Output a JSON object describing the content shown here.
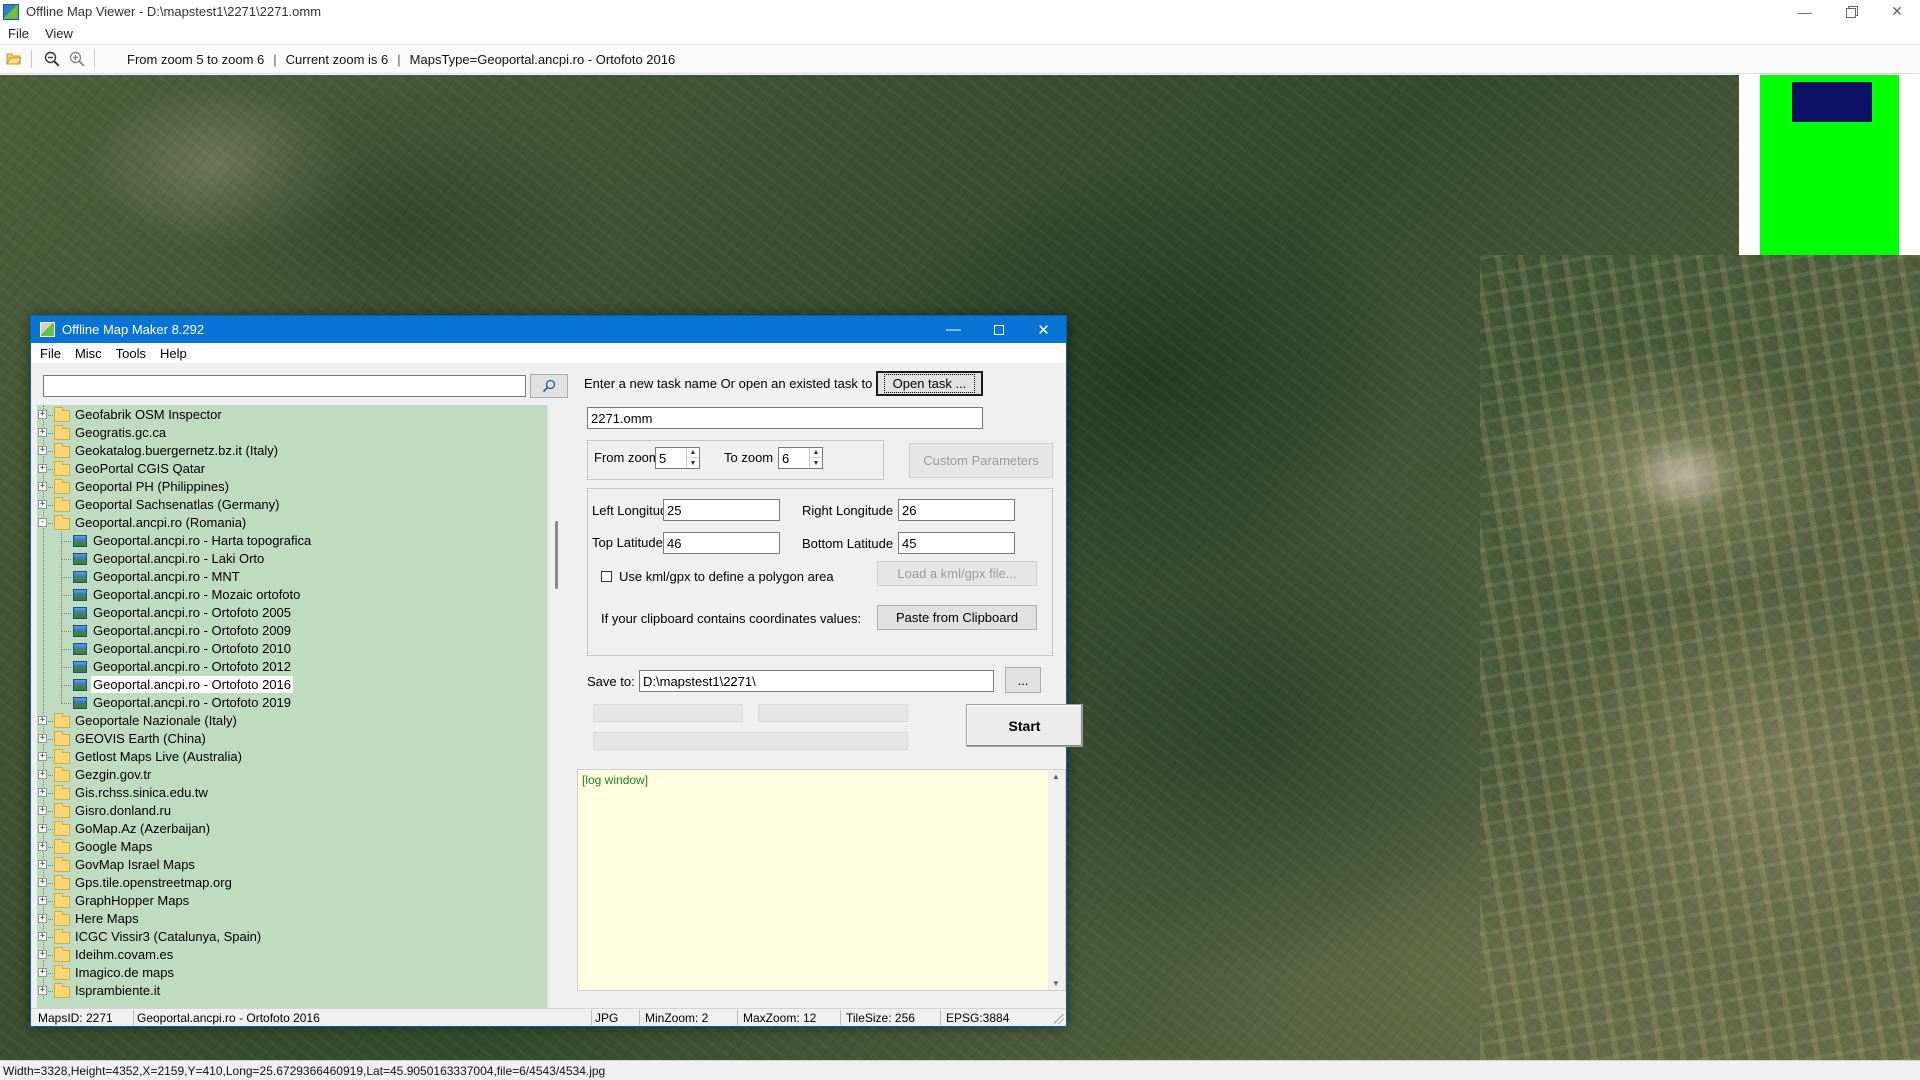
{
  "viewer": {
    "title": "Offline Map Viewer - D:\\mapstest1\\2271\\2271.omm",
    "menu": [
      "File",
      "View"
    ],
    "toolbar": {
      "zoom_range": "From zoom 5 to zoom 6",
      "current_zoom": "Current zoom is 6",
      "maps_type": "MapsType=Geoportal.ancpi.ro - Ortofoto 2016"
    },
    "status": "Width=3328,Height=4352,X=2159,Y=410,Long=25.6729366460919,Lat=45.9050163337004,file=6/4543/4534.jpg"
  },
  "dialog": {
    "title": "Offline Map Maker 8.292",
    "menu": [
      "File",
      "Misc",
      "Tools",
      "Help"
    ],
    "search": {
      "value": "",
      "placeholder": ""
    },
    "tree": [
      {
        "label": "Geofabrik OSM Inspector",
        "level": 0,
        "type": "folder",
        "expanded": false
      },
      {
        "label": "Geogratis.gc.ca",
        "level": 0,
        "type": "folder",
        "expanded": false
      },
      {
        "label": "Geokatalog.buergernetz.bz.it (Italy)",
        "level": 0,
        "type": "folder",
        "expanded": false
      },
      {
        "label": "GeoPortal CGIS Qatar",
        "level": 0,
        "type": "folder",
        "expanded": false
      },
      {
        "label": "Geoportal PH (Philippines)",
        "level": 0,
        "type": "folder",
        "expanded": false
      },
      {
        "label": "Geoportal Sachsenatlas (Germany)",
        "level": 0,
        "type": "folder",
        "expanded": false
      },
      {
        "label": "Geoportal.ancpi.ro (Romania)",
        "level": 0,
        "type": "folder",
        "expanded": true
      },
      {
        "label": "Geoportal.ancpi.ro - Harta topografica",
        "level": 1,
        "type": "map"
      },
      {
        "label": "Geoportal.ancpi.ro - Laki Orto",
        "level": 1,
        "type": "map"
      },
      {
        "label": "Geoportal.ancpi.ro - MNT",
        "level": 1,
        "type": "map"
      },
      {
        "label": "Geoportal.ancpi.ro - Mozaic ortofoto",
        "level": 1,
        "type": "map"
      },
      {
        "label": "Geoportal.ancpi.ro - Ortofoto 2005",
        "level": 1,
        "type": "map"
      },
      {
        "label": "Geoportal.ancpi.ro - Ortofoto 2009",
        "level": 1,
        "type": "map"
      },
      {
        "label": "Geoportal.ancpi.ro - Ortofoto 2010",
        "level": 1,
        "type": "map"
      },
      {
        "label": "Geoportal.ancpi.ro - Ortofoto 2012",
        "level": 1,
        "type": "map"
      },
      {
        "label": "Geoportal.ancpi.ro - Ortofoto 2016",
        "level": 1,
        "type": "map",
        "selected": true
      },
      {
        "label": "Geoportal.ancpi.ro - Ortofoto 2019",
        "level": 1,
        "type": "map"
      },
      {
        "label": "Geoportale Nazionale (Italy)",
        "level": 0,
        "type": "folder",
        "expanded": false
      },
      {
        "label": "GEOVIS Earth (China)",
        "level": 0,
        "type": "folder",
        "expanded": false
      },
      {
        "label": "Getlost Maps Live (Australia)",
        "level": 0,
        "type": "folder",
        "expanded": false
      },
      {
        "label": "Gezgin.gov.tr",
        "level": 0,
        "type": "folder",
        "expanded": false
      },
      {
        "label": "Gis.rchss.sinica.edu.tw",
        "level": 0,
        "type": "folder",
        "expanded": false
      },
      {
        "label": "Gisro.donland.ru",
        "level": 0,
        "type": "folder",
        "expanded": false
      },
      {
        "label": "GoMap.Az (Azerbaijan)",
        "level": 0,
        "type": "folder",
        "expanded": false
      },
      {
        "label": "Google Maps",
        "level": 0,
        "type": "folder",
        "expanded": false
      },
      {
        "label": "GovMap Israel Maps",
        "level": 0,
        "type": "folder",
        "expanded": false
      },
      {
        "label": "Gps.tile.openstreetmap.org",
        "level": 0,
        "type": "folder",
        "expanded": false
      },
      {
        "label": "GraphHopper Maps",
        "level": 0,
        "type": "folder",
        "expanded": false
      },
      {
        "label": "Here Maps",
        "level": 0,
        "type": "folder",
        "expanded": false
      },
      {
        "label": "ICGC Vissir3 (Catalunya, Spain)",
        "level": 0,
        "type": "folder",
        "expanded": false
      },
      {
        "label": "Ideihm.covam.es",
        "level": 0,
        "type": "folder",
        "expanded": false
      },
      {
        "label": "Imagico.de maps",
        "level": 0,
        "type": "folder",
        "expanded": false
      },
      {
        "label": "Isprambiente.it",
        "level": 0,
        "type": "folder",
        "expanded": false
      }
    ],
    "task_prompt": "Enter a new task name Or open an existed task to continue:",
    "open_task_label": "Open task ...",
    "task_name": "2271.omm",
    "from_zoom_label": "From zoom",
    "from_zoom": "5",
    "to_zoom_label": "To zoom",
    "to_zoom": "6",
    "custom_params_label": "Custom Parameters",
    "left_longitude_label": "Left Longitude",
    "left_longitude": "25",
    "right_longitude_label": "Right Longitude",
    "right_longitude": "26",
    "top_latitude_label": "Top Latitude",
    "top_latitude": "46",
    "bottom_latitude_label": "Bottom Latitude",
    "bottom_latitude": "45",
    "kml_checkbox_label": "Use kml/gpx to define a polygon area",
    "kml_checked": false,
    "load_kml_label": "Load a kml/gpx file...",
    "clipboard_prompt": "If your clipboard contains coordinates values:",
    "paste_label": "Paste from Clipboard",
    "save_to_label": "Save to:",
    "save_to": "D:\\mapstest1\\2271\\",
    "browse_label": "...",
    "start_label": "Start",
    "log_text": "[log window]",
    "status": {
      "maps_id": "MapsID: 2271",
      "map_name": "Geoportal.ancpi.ro - Ortofoto 2016",
      "format": "JPG",
      "min_zoom": "MinZoom: 2",
      "max_zoom": "MaxZoom: 12",
      "tile_size": "TileSize: 256",
      "epsg": "EPSG:3884"
    }
  },
  "colors": {
    "overview_green": "#00ff00",
    "overview_view": "#0c1166",
    "dialog_title": "#0a74d6",
    "tree_background": "#c0dcc0",
    "log_background": "#ffffe1",
    "log_text": "#208020"
  },
  "icons": [
    "open-folder-icon",
    "zoom-out-icon",
    "zoom-in-icon",
    "search-icon",
    "folder-icon",
    "map-layer-icon",
    "app-icon"
  ]
}
